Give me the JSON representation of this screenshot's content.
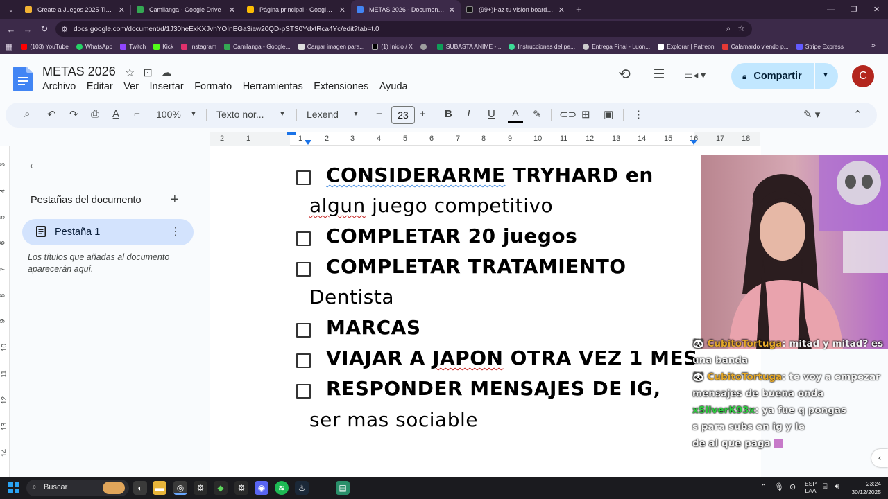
{
  "browser": {
    "tabs": [
      {
        "title": "Create a Juegos 2025 Tier List -",
        "favicon_color": "#f2b233",
        "active": false
      },
      {
        "title": "Camilanga - Google Drive",
        "favicon_color": "#34a853",
        "active": false
      },
      {
        "title": "Página principal - Google Drive",
        "favicon_color": "#fbbc04",
        "active": false
      },
      {
        "title": "METAS 2026 - Documentos de",
        "favicon_color": "#4285f4",
        "active": true
      },
      {
        "title": "(99+)Haz tu vision board 2026 |",
        "favicon_color": "#111111",
        "active": false
      }
    ],
    "url": "docs.google.com/document/d/1J30heExKXJvhYOInEGa3iaw20QD-pSTS0YdxtRca4Yc/edit?tab=t.0",
    "bookmarks": [
      {
        "label": "(103) YouTube",
        "color": "#ff0000"
      },
      {
        "label": "WhatsApp",
        "color": "#25d366"
      },
      {
        "label": "Twitch",
        "color": "#9146ff"
      },
      {
        "label": "Kick",
        "color": "#53fc18"
      },
      {
        "label": "Instagram",
        "color": "#e1306c"
      },
      {
        "label": "Camilanga - Google...",
        "color": "#34a853"
      },
      {
        "label": "Cargar imagen para...",
        "color": "#ffffff"
      },
      {
        "label": "(1) Inicio / X",
        "color": "#000000"
      },
      {
        "label": "",
        "color": "#9e9e9e"
      },
      {
        "label": "SUBASTA ANIME -...",
        "color": "#0f9d58"
      },
      {
        "label": "Instrucciones del pe...",
        "color": "#3ddc97"
      },
      {
        "label": "Entrega Final - Luon...",
        "color": "#cccccc"
      },
      {
        "label": "Explorar | Patreon",
        "color": "#ffffff"
      },
      {
        "label": "Calamardo viendo p...",
        "color": "#e53935"
      },
      {
        "label": "Stripe Express",
        "color": "#635bff"
      }
    ]
  },
  "docs": {
    "title": "METAS 2026",
    "menu": [
      "Archivo",
      "Editar",
      "Ver",
      "Insertar",
      "Formato",
      "Herramientas",
      "Extensiones",
      "Ayuda"
    ],
    "share_label": "Compartir",
    "avatar_letter": "C",
    "toolbar": {
      "zoom": "100%",
      "style": "Texto nor...",
      "font": "Lexend",
      "font_size": "23"
    },
    "ruler_ticks": [
      "2",
      "1",
      "1",
      "2",
      "3",
      "4",
      "5",
      "6",
      "7",
      "8",
      "9",
      "10",
      "11",
      "12",
      "13",
      "14",
      "15",
      "16",
      "17",
      "18"
    ],
    "vruler_ticks": [
      "3",
      "4",
      "5",
      "6",
      "7",
      "8",
      "9",
      "10",
      "11",
      "12",
      "13",
      "14"
    ],
    "sidebar": {
      "heading": "Pestañas del documento",
      "tab_label": "Pestaña 1",
      "hint": "Los títulos que añadas al documento aparecerán aquí."
    },
    "content": {
      "item1_a": "CONSIDERARME",
      "item1_b": " TRYHARD en",
      "item1_c": "algun",
      "item1_d": " juego competitivo",
      "item2": "COMPLETAR 20 juegos",
      "item3_a": "COMPLETAR TRATAMIENTO",
      "item3_b": "Dentista",
      "item4": "MARCAS",
      "item5_a": "VIAJAR A ",
      "item5_b": "JAPON",
      "item5_c": " OTRA VEZ 1 MES",
      "item6_a": "RESPONDER MENSAJES DE IG,",
      "item6_b": "ser mas sociable"
    }
  },
  "chat": [
    {
      "user": "CubitoTortuga",
      "text": ": mitad y mitad? es"
    },
    {
      "user": "",
      "text": "una banda"
    },
    {
      "user": "CubitoTortuga",
      "text": ": te voy a empezar"
    },
    {
      "user": "",
      "text": "mensajes de buena onda"
    },
    {
      "user": "xSilverK93x",
      "text": ": ya fue q pongas"
    },
    {
      "user": "",
      "text": "s para subs en ig y le"
    },
    {
      "user": "",
      "text": "de al que paga"
    }
  ],
  "taskbar": {
    "search_label": "Buscar",
    "lang_top": "ESP",
    "lang_bottom": "LAA",
    "time": "23:24",
    "date": "30/12/2025"
  }
}
